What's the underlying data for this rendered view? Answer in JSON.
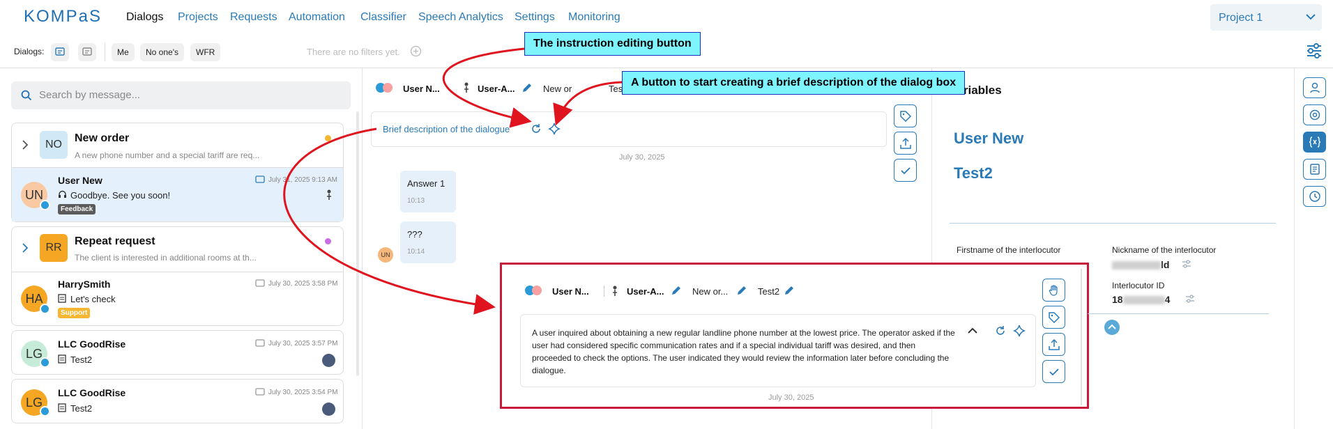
{
  "app": {
    "logo": "KOMPaS",
    "project": "Project 1"
  },
  "nav": [
    {
      "label": "Dialogs",
      "active": true
    },
    {
      "label": "Projects"
    },
    {
      "label": "Requests"
    },
    {
      "label": "Automation"
    },
    {
      "label": "Classifier"
    },
    {
      "label": "Speech Analytics"
    },
    {
      "label": "Settings"
    },
    {
      "label": "Monitoring"
    }
  ],
  "toolbar": {
    "dialogs_label": "Dialogs:",
    "chips": [
      "Me",
      "No one's",
      "WFR"
    ],
    "filters_text": "There are no filters yet."
  },
  "search": {
    "placeholder": "Search by message..."
  },
  "groups": [
    {
      "initials": "NO",
      "title": "New order",
      "desc": "A new phone number and a special tariff are req...",
      "dot": "#f5b731"
    },
    {
      "initials": "RR",
      "title": "Repeat request",
      "desc": "The client is interested in additional rooms at th...",
      "dot": "#c86de3"
    }
  ],
  "dialogs": [
    {
      "initials": "UN",
      "name": "User New",
      "message": "Goodbye. See you soon!",
      "date": "July 31, 2025 9:13 AM",
      "badge": "Feedback"
    },
    {
      "initials": "HA",
      "name": "HarrySmith",
      "message": "Let's check",
      "date": "July 30, 2025 3:58 PM",
      "badge": "Support"
    },
    {
      "initials": "LG",
      "name": "LLC GoodRise",
      "message": "Test2",
      "date": "July 30, 2025 3:57 PM"
    },
    {
      "initials": "LG",
      "name": "LLC GoodRise",
      "message": "Test2",
      "date": "July 30, 2025 3:54 PM"
    }
  ],
  "chat": {
    "header": {
      "user": "User N...",
      "assignee": "User-A...",
      "group": "New or",
      "tag": "Test"
    },
    "brief_placeholder": "Brief description of the dialogue",
    "date_sep": "July 30, 2025",
    "messages": [
      {
        "text": "Answer 1",
        "time": "10:13"
      },
      {
        "text": "???",
        "time": "10:14"
      }
    ],
    "avatar_initials": "UN"
  },
  "variables": {
    "title": "Variables",
    "values": [
      "User New",
      "Test2"
    ],
    "fields": [
      {
        "label": "Firstname of the interlocutor"
      },
      {
        "label": "Nickname of the interlocutor",
        "value_suffix": "ld"
      },
      {
        "label": "Interlocutor ID",
        "value_prefix": "18",
        "value_suffix": "4"
      }
    ]
  },
  "callouts": {
    "instruction": "The instruction editing button",
    "brief": "A button to start creating a brief description of the dialog box"
  },
  "zoom": {
    "user": "User N...",
    "assignee": "User-A...",
    "group": "New or...",
    "tag": "Test2",
    "summary": "A user inquired about obtaining a new regular landline phone number at the lowest price. The operator asked if the user had considered specific communication rates and if a special individual tariff was desired, and then proceeded to check the options. The user indicated they would review the information later before concluding the dialogue.",
    "date": "July 30, 2025"
  },
  "colors": {
    "accent": "#2a7ab8",
    "callout_bg": "#7ef4ff",
    "zoom_border": "#c8193c",
    "arrow": "#e0141e"
  }
}
